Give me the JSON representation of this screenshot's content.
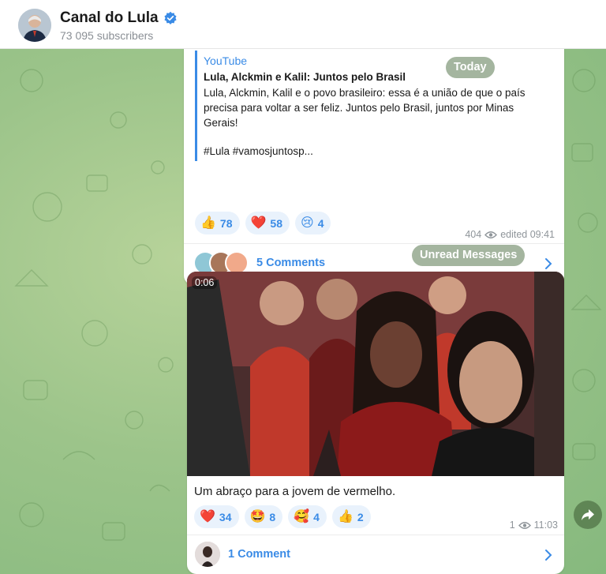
{
  "header": {
    "channel_name": "Canal do Lula",
    "subscribers": "73 095 subscribers",
    "verified_icon": "verified-badge-icon"
  },
  "dates": {
    "today": "Today",
    "unread": "Unread Messages"
  },
  "message1": {
    "preview_site": "YouTube",
    "preview_title": "Lula, Alckmin e Kalil: Juntos pelo Brasil",
    "preview_description": "Lula, Alckmin, Kalil e o povo brasileiro: essa é a união de que o país precisa para voltar a ser feliz. Juntos pelo Brasil, juntos por Minas Gerais!",
    "preview_tags": "#Lula #vamosjuntosp...",
    "reactions": [
      {
        "emoji": "👍",
        "count": "78"
      },
      {
        "emoji": "❤️",
        "count": "58"
      },
      {
        "emoji": "😢",
        "count": "4"
      }
    ],
    "views": "404",
    "edited": "edited 09:41",
    "comments_label": "5 Comments"
  },
  "message2": {
    "duration": "0:06",
    "caption": "Um abraço para a jovem de vermelho.",
    "reactions": [
      {
        "emoji": "❤️",
        "count": "34"
      },
      {
        "emoji": "🤩",
        "count": "8"
      },
      {
        "emoji": "🥰",
        "count": "4"
      },
      {
        "emoji": "👍",
        "count": "2"
      }
    ],
    "views": "1",
    "time": "11:03",
    "comments_label": "1 Comment"
  },
  "colors": {
    "accent": "#3a8be6",
    "chat_bg": "#9cc48a"
  }
}
